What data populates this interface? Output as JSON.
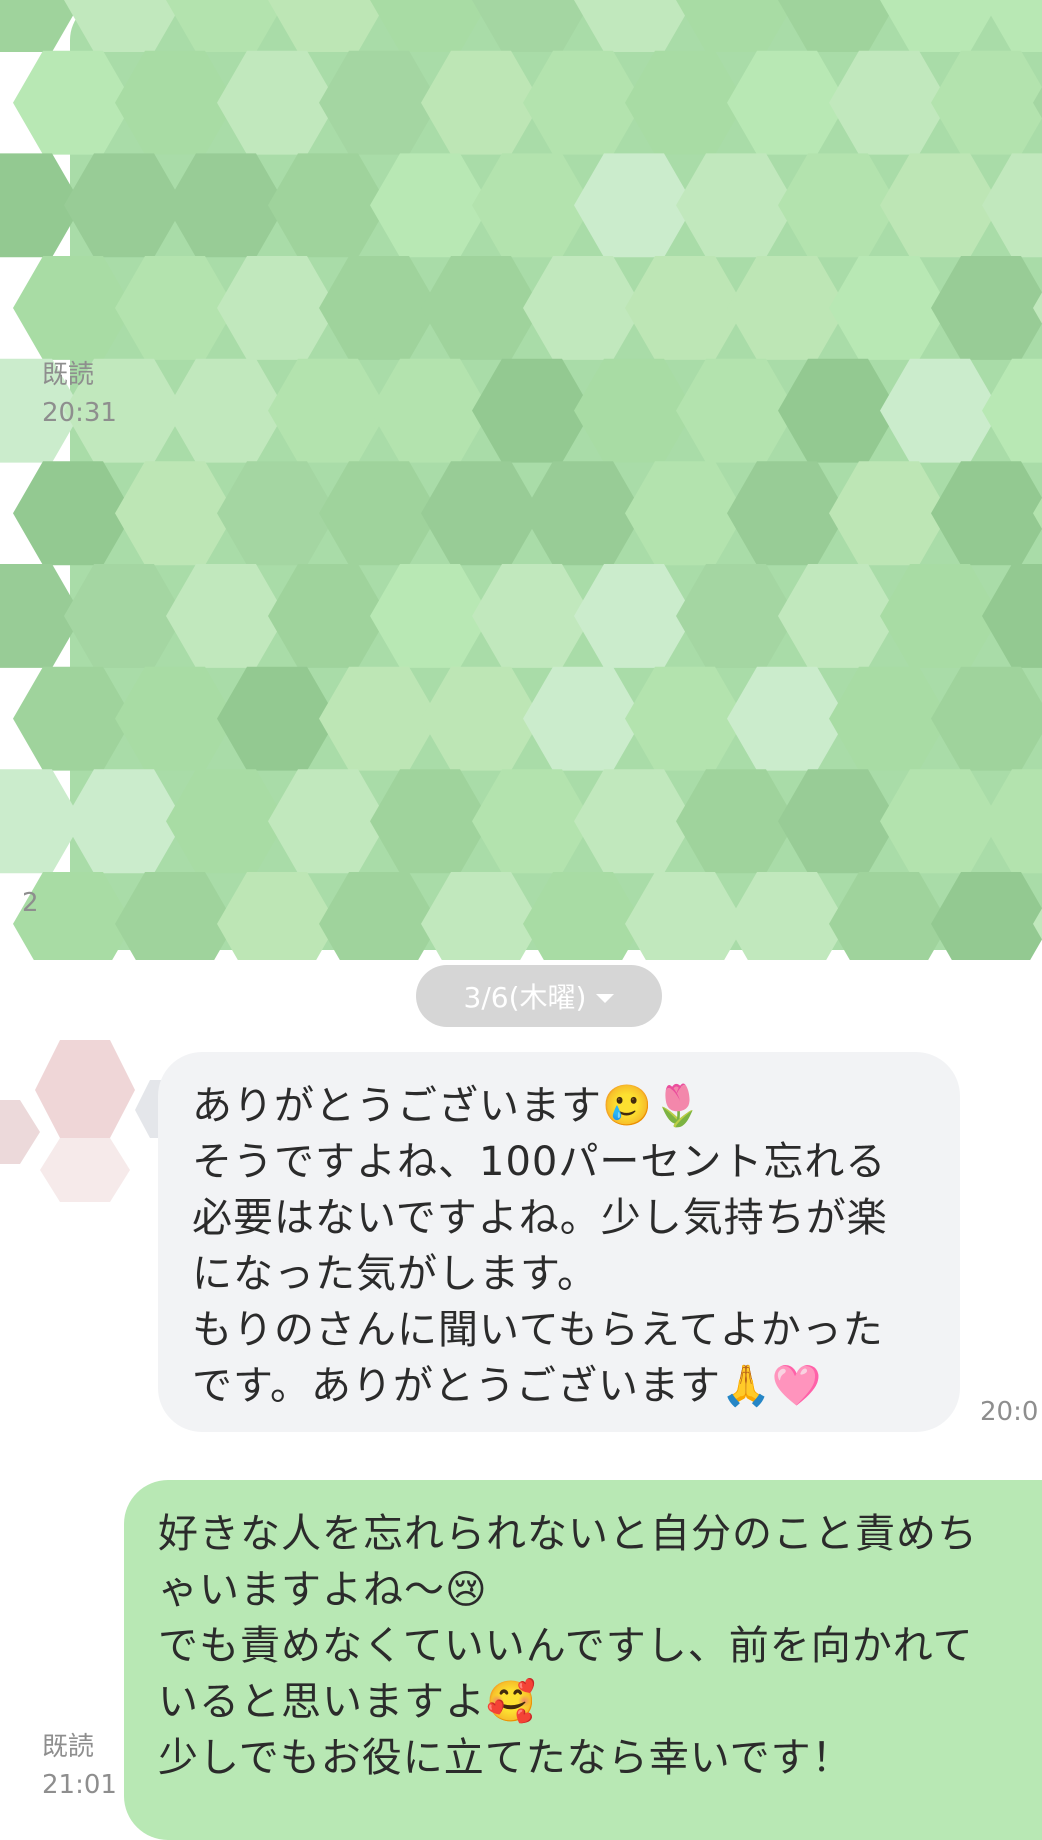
{
  "colors": {
    "incoming_bubble": "#f2f3f5",
    "outgoing_bubble": "#b8e8b4",
    "meta_text": "#8e8e8e",
    "date_chip": "#d6d6d6"
  },
  "top_message": {
    "read_label": "既読",
    "time": "20:31",
    "partial_time": "2"
  },
  "date_separator": {
    "label": "3/6(木曜)",
    "icon": "chevron-down-icon"
  },
  "incoming_message": {
    "lines": [
      "ありがとうございます🥲🌷",
      "そうですよね、100パーセント忘れる",
      "必要はないですよね。少し気持ちが楽",
      "になった気がします。",
      "もりのさんに聞いてもらえてよかった",
      "です。ありがとうございます🙏🩷"
    ],
    "time": "20:0"
  },
  "outgoing_message": {
    "read_label": "既読",
    "time": "21:01",
    "lines": [
      "好きな人を忘れられないと自分のこと責めち",
      "ゃいますよね〜😢",
      "でも責めなくていいんですし、前を向かれて",
      "いると思いますよ🥰",
      "少しでもお役に立てたなら幸いです！"
    ]
  }
}
